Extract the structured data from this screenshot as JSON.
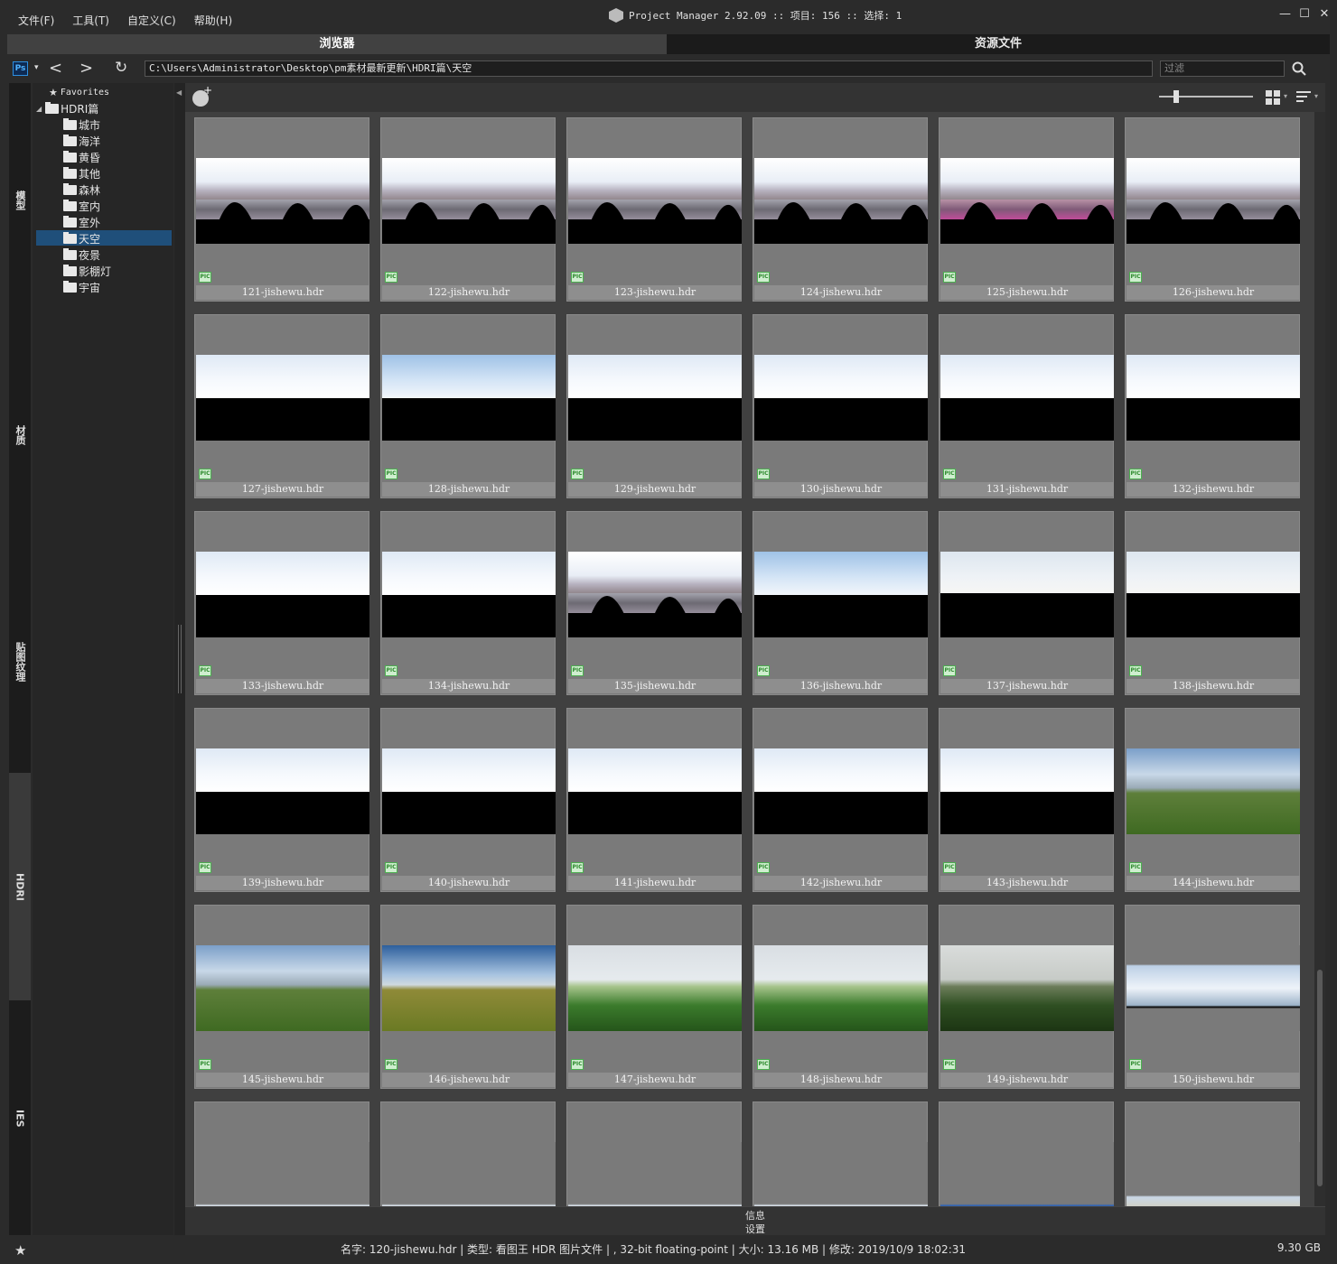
{
  "menu": [
    "文件(F)",
    "工具(T)",
    "自定义(C)",
    "帮助(H)"
  ],
  "window": {
    "title": "Project Manager 2.92.09  :: 项目: 156  :: 选择: 1",
    "min": "—",
    "max": "☐",
    "close": "✕"
  },
  "tabs": {
    "browser": "浏览器",
    "assets": "资源文件"
  },
  "pathbar": {
    "path": "C:\\Users\\Administrator\\Desktop\\pm素材最新更新\\HDRI篇\\天空",
    "filter_placeholder": "过滤",
    "ps_label": "Ps"
  },
  "vtabs": [
    "模型",
    "材质",
    "贴图纹理",
    "HDRI",
    "IES"
  ],
  "tree": {
    "favorites": "Favorites",
    "root": "HDRI篇",
    "children": [
      "城市",
      "海洋",
      "黄昏",
      "其他",
      "森林",
      "室内",
      "室外",
      "天空",
      "夜景",
      "影棚灯",
      "宇宙"
    ],
    "selected_index": 7
  },
  "grid": {
    "items": [
      "121-jishewu.hdr",
      "122-jishewu.hdr",
      "123-jishewu.hdr",
      "124-jishewu.hdr",
      "125-jishewu.hdr",
      "126-jishewu.hdr",
      "127-jishewu.hdr",
      "128-jishewu.hdr",
      "129-jishewu.hdr",
      "130-jishewu.hdr",
      "131-jishewu.hdr",
      "132-jishewu.hdr",
      "133-jishewu.hdr",
      "134-jishewu.hdr",
      "135-jishewu.hdr",
      "136-jishewu.hdr",
      "137-jishewu.hdr",
      "138-jishewu.hdr",
      "139-jishewu.hdr",
      "140-jishewu.hdr",
      "141-jishewu.hdr",
      "142-jishewu.hdr",
      "143-jishewu.hdr",
      "144-jishewu.hdr",
      "145-jishewu.hdr",
      "146-jishewu.hdr",
      "147-jishewu.hdr",
      "148-jishewu.hdr",
      "149-jishewu.hdr",
      "150-jishewu.hdr",
      "",
      "",
      "",
      "",
      "",
      ""
    ],
    "badge": "PIC"
  },
  "infotabs": {
    "info": "信息",
    "settings": "设置"
  },
  "status": {
    "text": "名字: 120-jishewu.hdr | 类型: 看图王 HDR 图片文件 | , 32-bit floating-point | 大小: 13.16 MB | 修改: 2019/10/9 18:02:31",
    "disk": "9.30 GB"
  }
}
